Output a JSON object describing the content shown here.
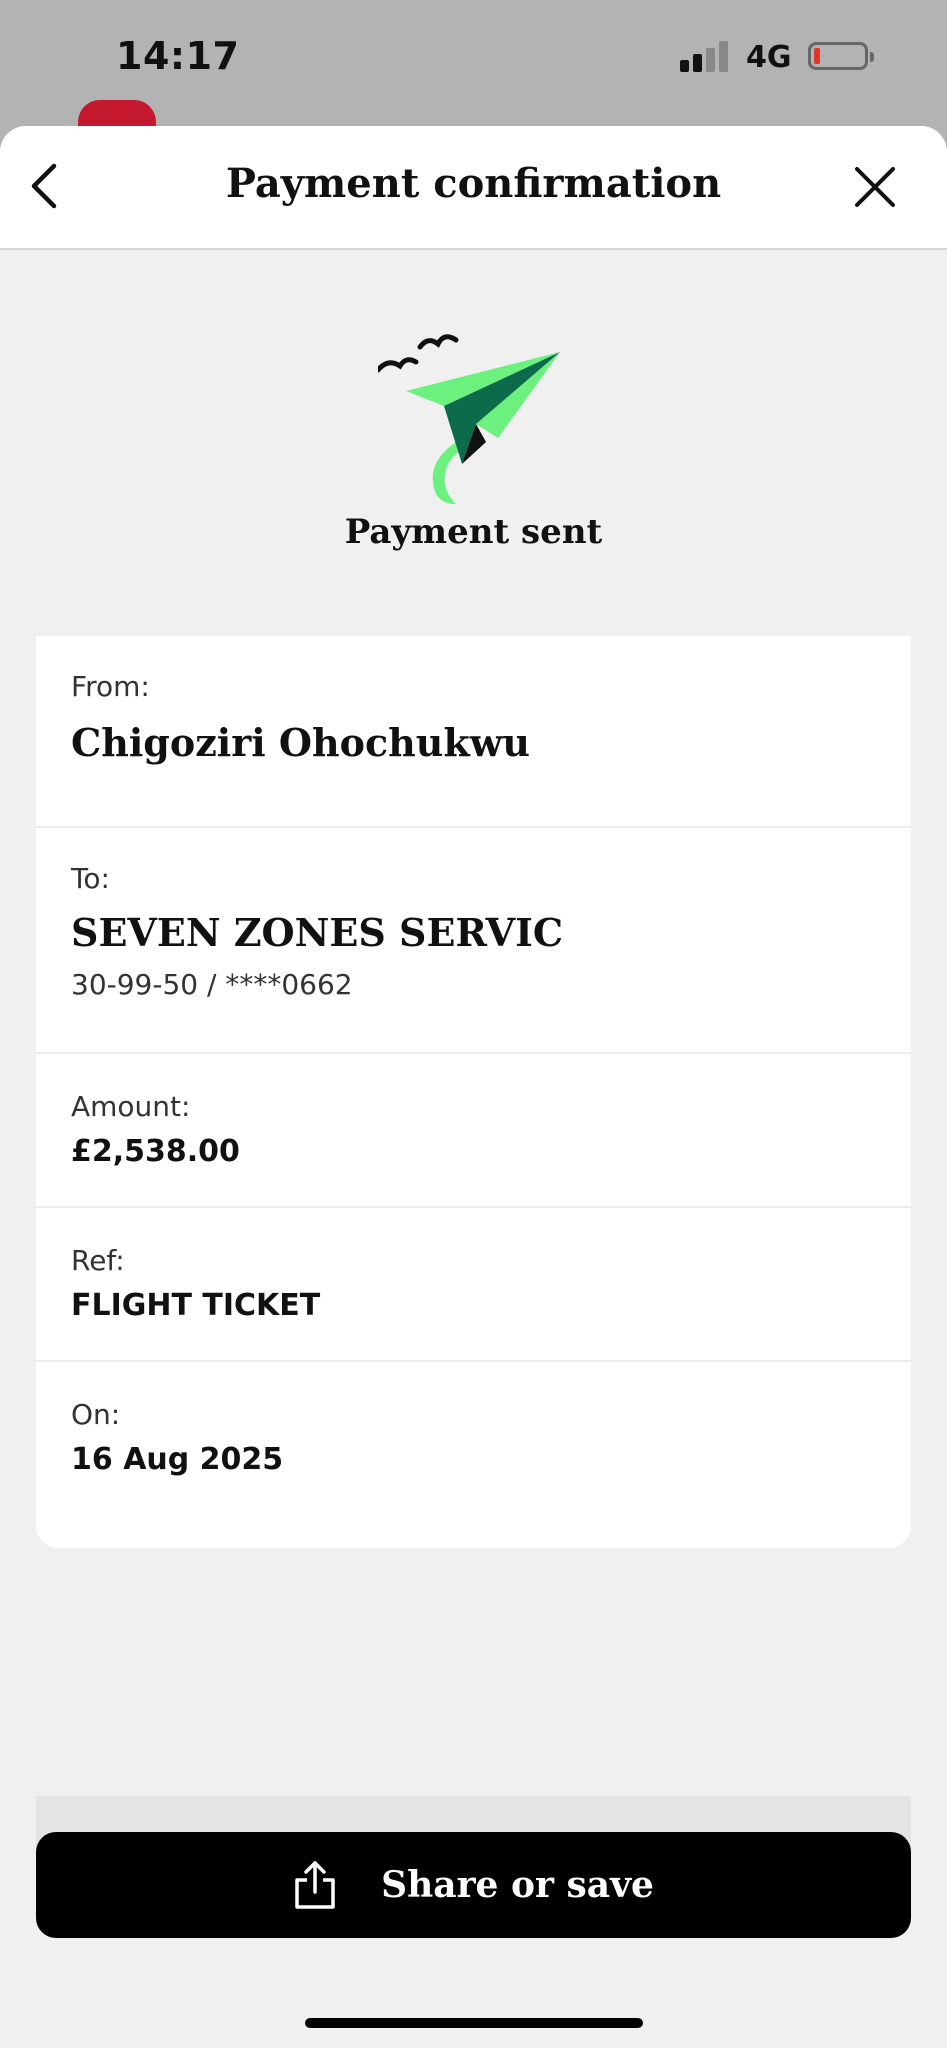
{
  "status_bar": {
    "time": "14:17",
    "network": "4G"
  },
  "header": {
    "title": "Payment confirmation"
  },
  "hero": {
    "status_text": "Payment sent",
    "illustration": "paper-plane-icon",
    "colors": {
      "light_green": "#6cf07e",
      "dark_green": "#0b6b4a",
      "black": "#111111"
    }
  },
  "details": {
    "from_label": "From:",
    "from_value": "Chigoziri Ohochukwu",
    "to_label": "To:",
    "to_value": "SEVEN ZONES SERVIC",
    "to_account": "30-99-50 / ****0662",
    "amount_label": "Amount:",
    "amount_value": "£2,538.00",
    "ref_label": "Ref:",
    "ref_value": "FLIGHT TICKET",
    "on_label": "On:",
    "on_value": "16 Aug 2025"
  },
  "actions": {
    "share_label": "Share or save",
    "share_icon": "share-icon"
  }
}
